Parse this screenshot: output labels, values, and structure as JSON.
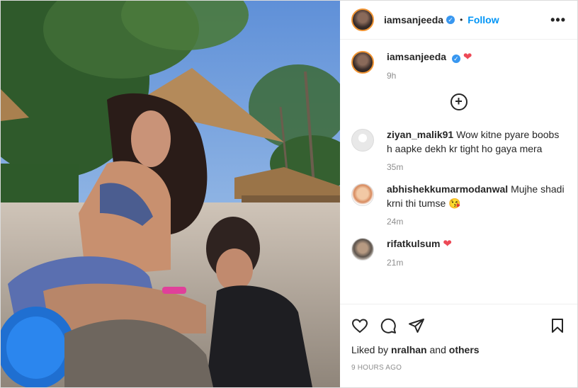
{
  "header": {
    "username": "iamsanjeeda",
    "verified_mark": "✓",
    "separator": "•",
    "follow_label": "Follow",
    "more_label": "•••"
  },
  "caption": {
    "username": "iamsanjeeda",
    "verified_mark": "✓",
    "emoji": "❤",
    "time": "9h"
  },
  "load_more_icon": "⊕",
  "comments": [
    {
      "username": "ziyan_malik91",
      "text": "Wow kitne pyare boobs h aapke dekh kr tight ho gaya mera",
      "time": "35m"
    },
    {
      "username": "abhishekkumarmodanwal",
      "text": "Mujhe shadi krni thi tumse 😘",
      "time": "24m"
    },
    {
      "username": "rifatkulsum",
      "text": "❤",
      "time": "21m"
    }
  ],
  "actions": {
    "icons": [
      "heart-outline-icon",
      "comment-icon",
      "share-icon",
      "bookmark-icon"
    ]
  },
  "likes": {
    "prefix": "Liked by",
    "user": "nralhan",
    "conj": "and",
    "others": "others"
  },
  "posted": "9 HOURS AGO",
  "colors": {
    "accent": "#0095f6",
    "verified": "#3897f0",
    "heart": "#ed4956",
    "muted": "#8e8e8e",
    "text": "#262626"
  }
}
